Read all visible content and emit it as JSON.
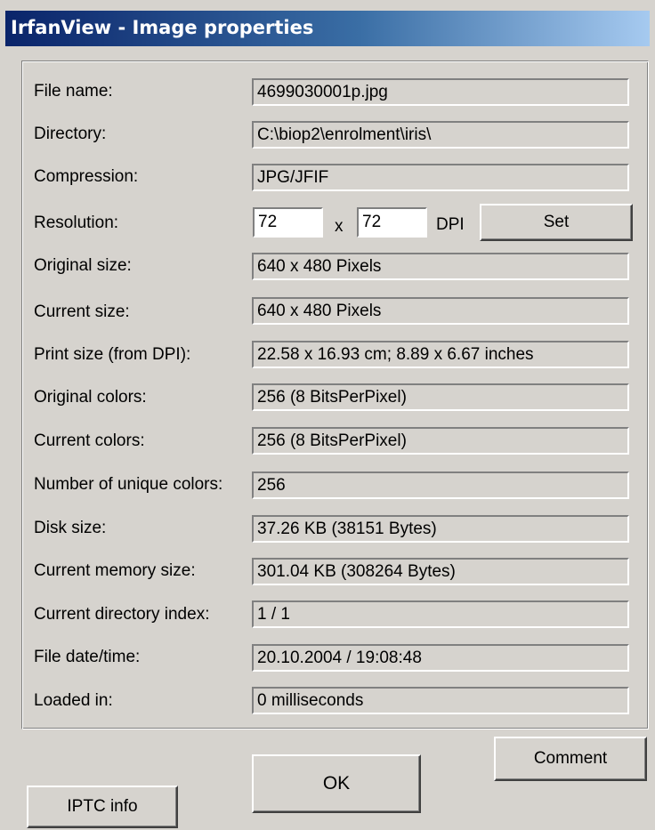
{
  "window": {
    "title": "IrfanView - Image properties"
  },
  "fields": [
    {
      "label": "File name:",
      "value": "4699030001p.jpg"
    },
    {
      "label": "Directory:",
      "value": "C:\\biop2\\enrolment\\iris\\"
    },
    {
      "label": "Compression:",
      "value": "JPG/JFIF"
    },
    {
      "label": "Original size:",
      "value": "640 x 480  Pixels"
    },
    {
      "label": "Current size:",
      "value": "640 x 480  Pixels"
    },
    {
      "label": "Print size (from DPI):",
      "value": "22.58 x 16.93 cm; 8.89 x 6.67 inches"
    },
    {
      "label": "Original colors:",
      "value": "256  (8 BitsPerPixel)"
    },
    {
      "label": "Current colors:",
      "value": "256  (8 BitsPerPixel)"
    },
    {
      "label": "Number of unique colors:",
      "value": "256"
    },
    {
      "label": "Disk size:",
      "value": "37.26  KB (38151 Bytes)"
    },
    {
      "label": "Current memory size:",
      "value": "301.04  KB (308264 Bytes)"
    },
    {
      "label": "Current directory index:",
      "value": "1  /  1"
    },
    {
      "label": "File date/time:",
      "value": "20.10.2004 / 19:08:48"
    },
    {
      "label": "Loaded in:",
      "value": "0 milliseconds"
    }
  ],
  "resolution": {
    "label": "Resolution:",
    "x_value": "72",
    "separator": "x",
    "y_value": "72",
    "unit": "DPI",
    "set_label": "Set"
  },
  "buttons": {
    "comment": "Comment",
    "ok": "OK",
    "iptc": "IPTC info"
  }
}
